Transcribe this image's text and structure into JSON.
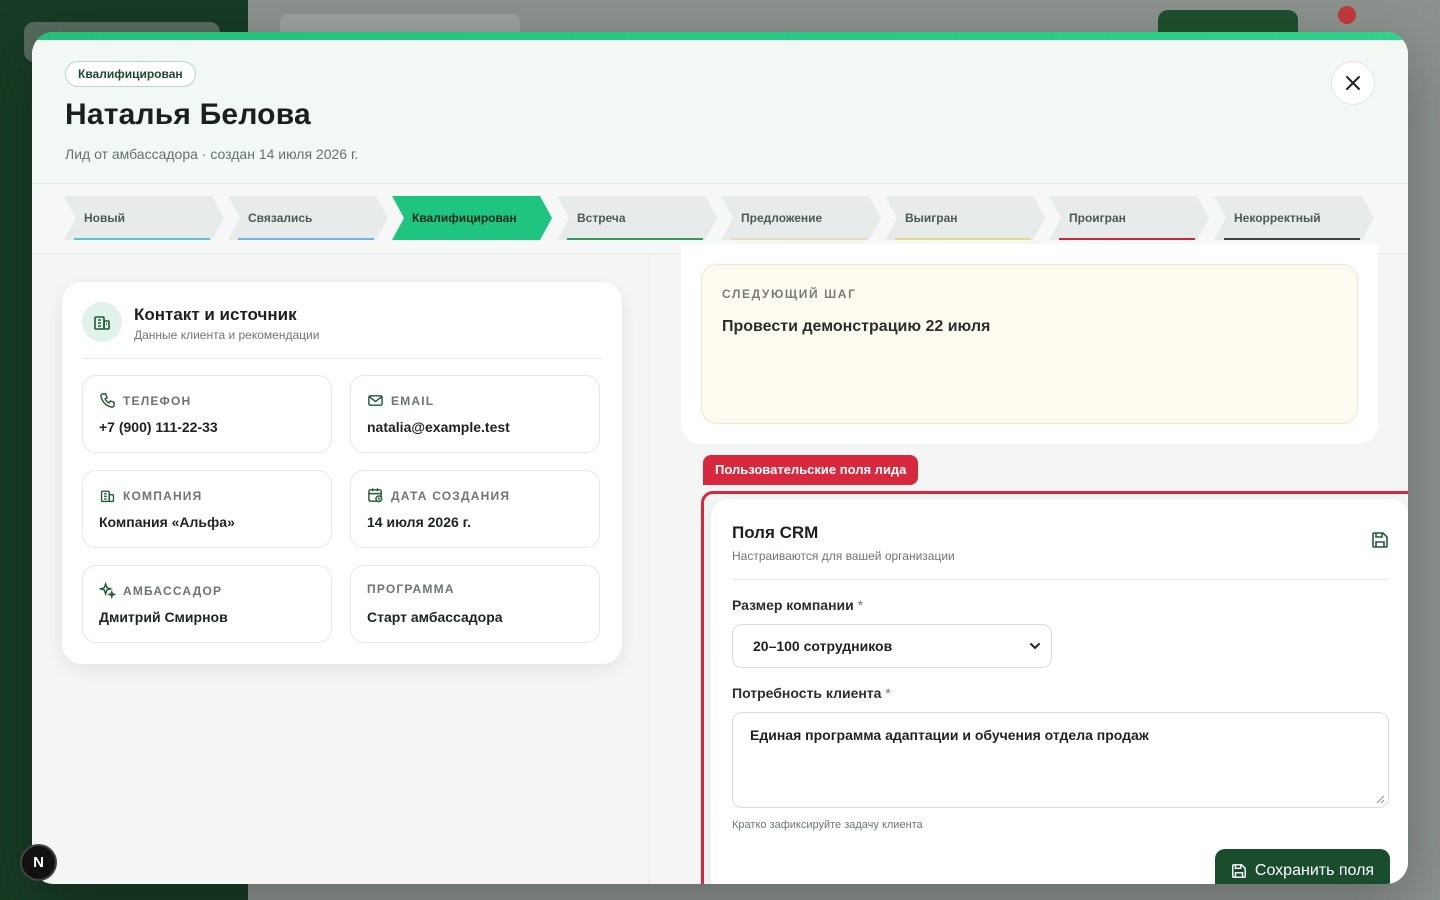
{
  "header": {
    "status_badge": "Квалифицирован",
    "name": "Наталья Белова",
    "subtitle": "Лид от амбассадора · создан 14 июля 2026 г."
  },
  "pipeline": {
    "stages": [
      {
        "label": "Новый",
        "color": "#58c3d6"
      },
      {
        "label": "Связались",
        "color": "#6fb3e0"
      },
      {
        "label": "Квалифицирован",
        "color": "#1fc481"
      },
      {
        "label": "Встреча",
        "color": "#2f9b5c"
      },
      {
        "label": "Предложение",
        "color": "#e6dcc0"
      },
      {
        "label": "Выигран",
        "color": "#e4d98a"
      },
      {
        "label": "Проигран",
        "color": "#c7263c"
      },
      {
        "label": "Некорректный",
        "color": "#3a4540"
      }
    ],
    "active": "Квалифицирован"
  },
  "contact_card": {
    "title": "Контакт и источник",
    "subtitle": "Данные клиента и рекомендации",
    "fields": [
      {
        "label": "ТЕЛЕФОН",
        "value": "+7 (900) 111-22-33",
        "icon": "phone-icon"
      },
      {
        "label": "EMAIL",
        "value": "natalia@example.test",
        "icon": "mail-icon"
      },
      {
        "label": "КОМПАНИЯ",
        "value": "Компания «Альфа»",
        "icon": "building-icon"
      },
      {
        "label": "ДАТА СОЗДАНИЯ",
        "value": "14 июля 2026 г.",
        "icon": "calendar-icon"
      },
      {
        "label": "АМБАССАДОР",
        "value": "Дмитрий Смирнов",
        "icon": "sparkle-icon"
      },
      {
        "label": "ПРОГРАММА",
        "value": "Старт амбассадора",
        "icon": ""
      }
    ]
  },
  "next_step": {
    "label": "СЛЕДУЮЩИЙ ШАГ",
    "text": "Провести демонстрацию 22 июля"
  },
  "custom_fields_tag": "Пользовательские поля лида",
  "crm": {
    "title": "Поля CRM",
    "subtitle": "Настраиваются для вашей организации",
    "size_label": "Размер компании",
    "size_value": "20–100 сотрудников",
    "need_label": "Потребность клиента",
    "need_value": "Единая программа адаптации и обучения отдела продаж",
    "required_mark": "*",
    "hint": "Кратко зафиксируйте задачу клиента",
    "save_label": "Сохранить поля"
  },
  "colors": {
    "accent_green": "#1fc481",
    "dark_green": "#1a4d2e",
    "highlight_red": "#d8283e"
  },
  "dev_badge": "N"
}
